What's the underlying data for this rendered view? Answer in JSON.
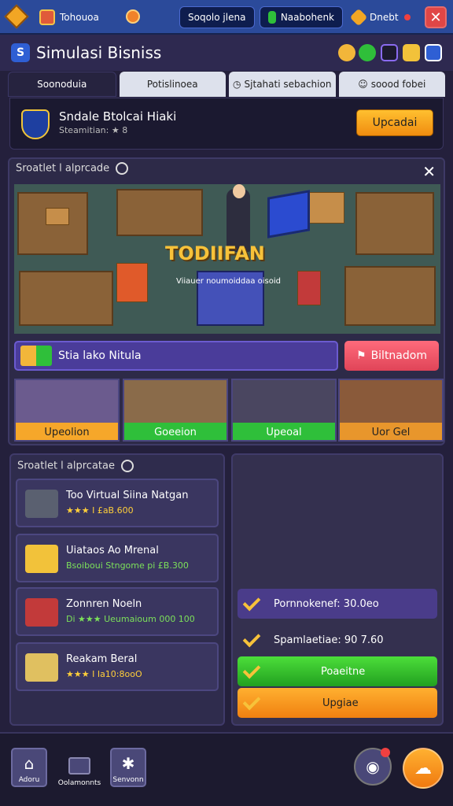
{
  "topbar": {
    "coins": "Tohouoa",
    "tab1": "Soqolo jlena",
    "tab2": "Naabohenk",
    "tab3": "Dnebt",
    "close": "✕"
  },
  "title": {
    "logo": "S",
    "text": "Simulasi Bisniss"
  },
  "tabs": [
    {
      "label": "Soonoduia"
    },
    {
      "label": "Potislinoea"
    },
    {
      "label": "Sjtahati sebachion"
    },
    {
      "label": "soood fobei"
    }
  ],
  "quest": {
    "title": "Sndale Btolcai Hiaki",
    "sub": "Steamitian: ★ 8",
    "button": "Upcadai"
  },
  "game": {
    "title": "Sroatlet l alprcade",
    "banner": "TODIIFAN",
    "caption": "Viiauer noumoiddaa oisoid",
    "task_label": "Stia lako Nitula",
    "rich_button": "Biltnadom",
    "cards": [
      {
        "label": "Upeolion",
        "color": "#f6a72a"
      },
      {
        "label": "Goeeion",
        "color": "#2fbf3a"
      },
      {
        "label": "Upeoal",
        "color": "#2fbf3a"
      },
      {
        "label": "Uor Gel",
        "color": "#e8962c"
      }
    ]
  },
  "list": {
    "title": "Sroatlet l alprcatae",
    "items": [
      {
        "title": "Too Virtual Siina Natgan",
        "sub": "★★★ I £aB.600"
      },
      {
        "title": "Uiataos Ao Mrenal",
        "sub": "Bsoiboui Stngome pi £B.300"
      },
      {
        "title": "Zonnren Noeln",
        "sub": "Di ★★★ Ueumaioum 000 100"
      },
      {
        "title": "Reakam Beral",
        "sub": "★★★ I Ia10:8ooO"
      }
    ]
  },
  "right": {
    "bars": [
      {
        "label": "Pornnokenef: 30.0eo",
        "style": "purple"
      },
      {
        "label": "Spamlaetiae: 90 7.60",
        "style": "plain"
      },
      {
        "label": "Poaeitne",
        "style": "green"
      },
      {
        "label": "Upgiae",
        "style": "orange"
      }
    ]
  },
  "nav": {
    "home": "Adoru",
    "shop": "Oolamonnts",
    "settings": "Senvonn"
  }
}
